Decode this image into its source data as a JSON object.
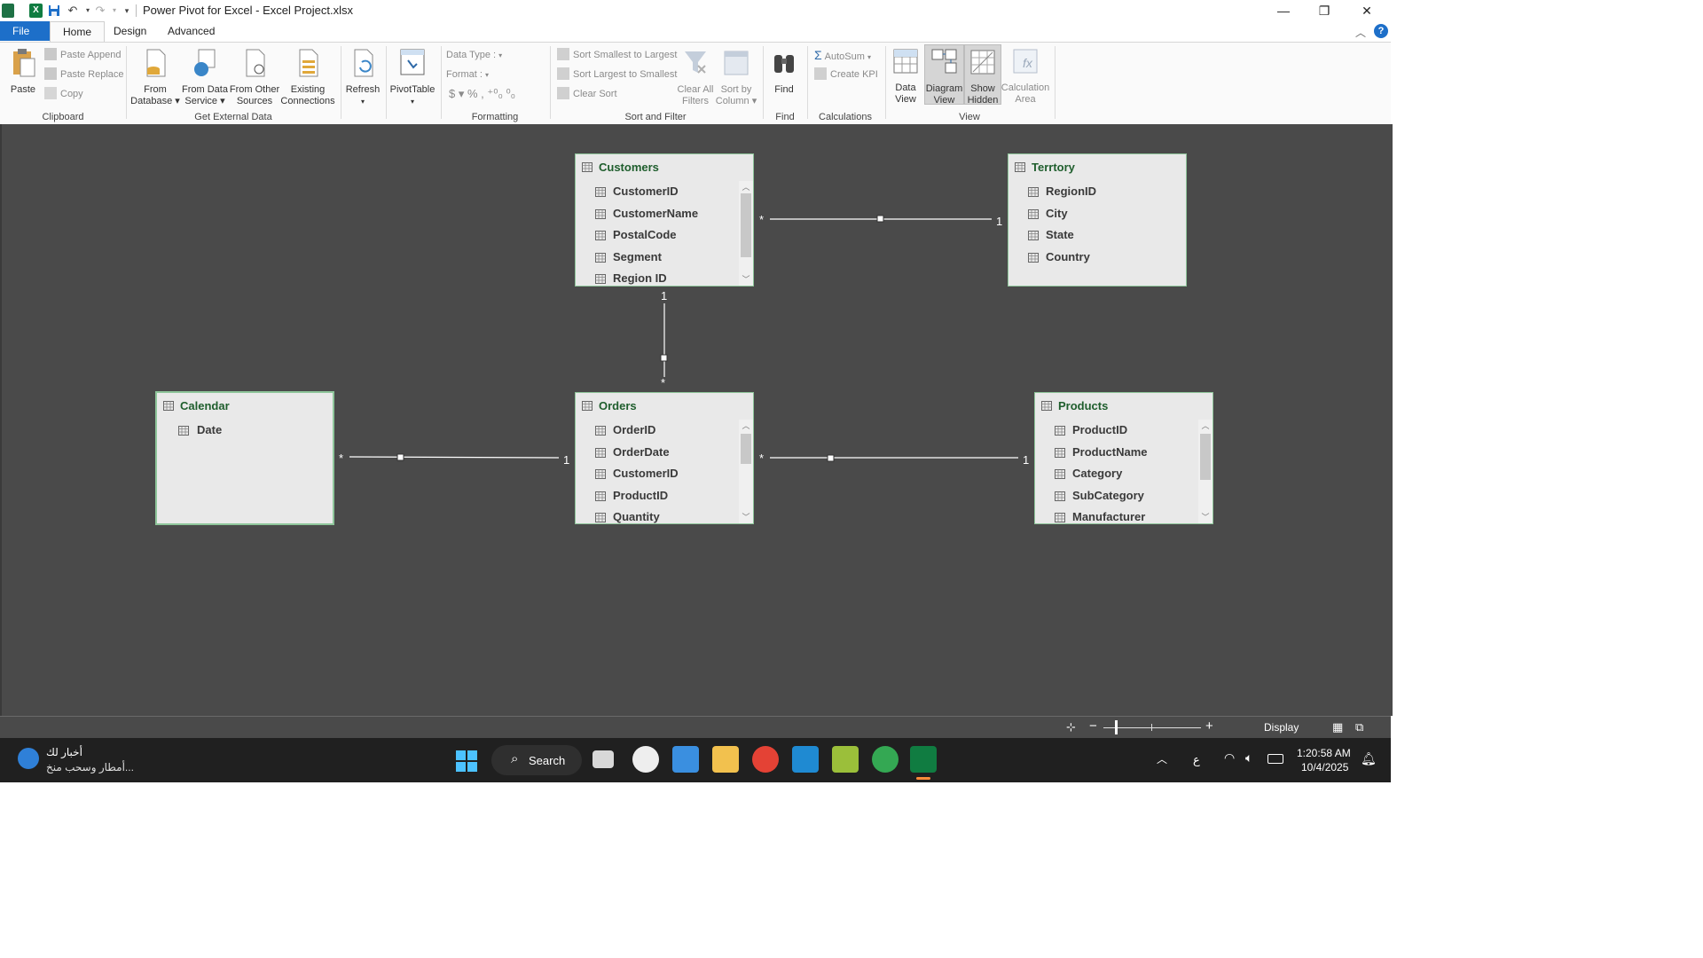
{
  "window": {
    "title": "Power Pivot for Excel - Excel Project.xlsx",
    "controls": {
      "minimize": "—",
      "restore": "❐",
      "close": "✕"
    }
  },
  "tabs": [
    {
      "label": "File"
    },
    {
      "label": "Home",
      "active": true
    },
    {
      "label": "Design"
    },
    {
      "label": "Advanced"
    }
  ],
  "ribbon": {
    "clipboard": {
      "label": "Clipboard",
      "paste": "Paste",
      "paste_append": "Paste Append",
      "paste_replace": "Paste Replace",
      "copy": "Copy"
    },
    "external": {
      "label": "Get External Data",
      "from_database": [
        "From",
        "Database"
      ],
      "from_data_service": [
        "From Data",
        "Service"
      ],
      "from_other": [
        "From Other",
        "Sources"
      ],
      "existing": [
        "Existing",
        "Connections"
      ]
    },
    "refresh": "Refresh",
    "pivottable": "PivotTable",
    "formatting": {
      "label": "Formatting",
      "data_type": "Data Type :",
      "format": "Format :",
      "symbols": "$ ▾  %  ,  ⁺⁰₀  ⁰₀"
    },
    "sort": {
      "label": "Sort and Filter",
      "asc": "Sort Smallest to Largest",
      "desc": "Sort Largest to Smallest",
      "clear": "Clear Sort",
      "clear_filters": [
        "Clear All",
        "Filters"
      ],
      "sort_by_column": [
        "Sort by",
        "Column"
      ]
    },
    "find": {
      "label": "Find",
      "button": "Find"
    },
    "calculations": {
      "label": "Calculations",
      "autosum": "AutoSum",
      "create_kpi": "Create KPI"
    },
    "view": {
      "label": "View",
      "data_view": [
        "Data",
        "View"
      ],
      "diagram_view": [
        "Diagram",
        "View"
      ],
      "show_hidden": [
        "Show",
        "Hidden"
      ],
      "calc_area": [
        "Calculation",
        "Area"
      ]
    }
  },
  "tables": {
    "customers": {
      "name": "Customers",
      "fields": [
        "CustomerID",
        "CustomerName",
        "PostalCode",
        "Segment",
        "Region ID"
      ]
    },
    "territory": {
      "name": "Terrtory",
      "fields": [
        "RegionID",
        "City",
        "State",
        "Country"
      ]
    },
    "calendar": {
      "name": "Calendar",
      "fields": [
        "Date"
      ]
    },
    "orders": {
      "name": "Orders",
      "fields": [
        "OrderID",
        "OrderDate",
        "CustomerID",
        "ProductID",
        "Quantity"
      ]
    },
    "products": {
      "name": "Products",
      "fields": [
        "ProductID",
        "ProductName",
        "Category",
        "SubCategory",
        "Manufacturer"
      ]
    }
  },
  "relationships": {
    "many": "*",
    "one": "1"
  },
  "statusbar": {
    "display": "Display"
  },
  "taskbar": {
    "news_title": "أخبار لك",
    "news_sub": "أمطار وسحب منخ...",
    "search": "Search",
    "lang": "ع",
    "time": "1:20:58 AM",
    "date": "10/4/2025"
  },
  "colors": {
    "accent": "#1d6fc9",
    "canvas": "#4a4a4a",
    "table_header": "#1f5e2d",
    "table_border": "#8ec59a"
  }
}
